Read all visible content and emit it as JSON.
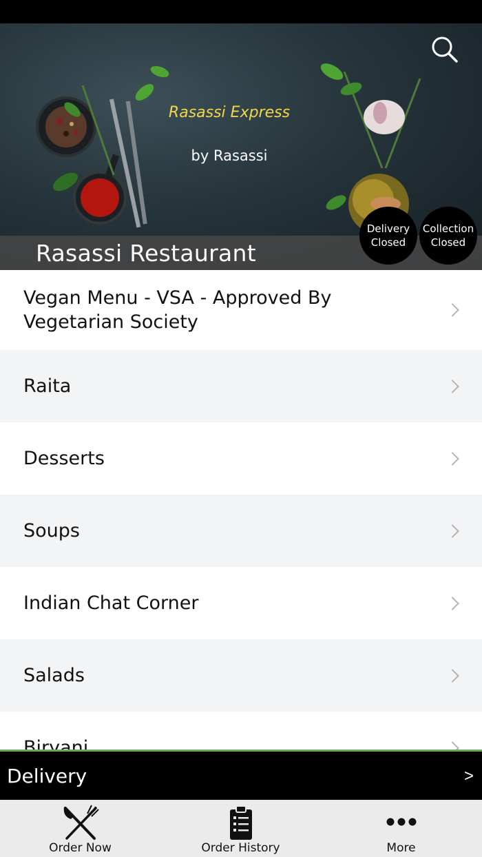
{
  "hero": {
    "tagline": "Rasassi Express",
    "byline": "by Rasassi",
    "restaurant_name": "Rasassi Restaurant",
    "delivery_status": [
      "Delivery",
      "Closed"
    ],
    "collection_status": [
      "Collection",
      "Closed"
    ]
  },
  "menu": {
    "items": [
      {
        "label": "Vegan Menu -  VSA - Approved By Vegetarian Society"
      },
      {
        "label": "Raita"
      },
      {
        "label": "Desserts"
      },
      {
        "label": "Soups"
      },
      {
        "label": "Indian Chat Corner"
      },
      {
        "label": "Salads"
      },
      {
        "label": "Biryani"
      }
    ]
  },
  "delivery_bar": {
    "label": "Delivery",
    "arrow": ">"
  },
  "tabs": [
    {
      "label": "Order Now",
      "icon": "fork-knife-icon"
    },
    {
      "label": "Order History",
      "icon": "clipboard-list-icon"
    },
    {
      "label": "More",
      "icon": "more-dots-icon"
    }
  ],
  "colors": {
    "tagline": "#f2d64b",
    "accent_line": "#6aa84f",
    "status_circle": "#000000"
  }
}
